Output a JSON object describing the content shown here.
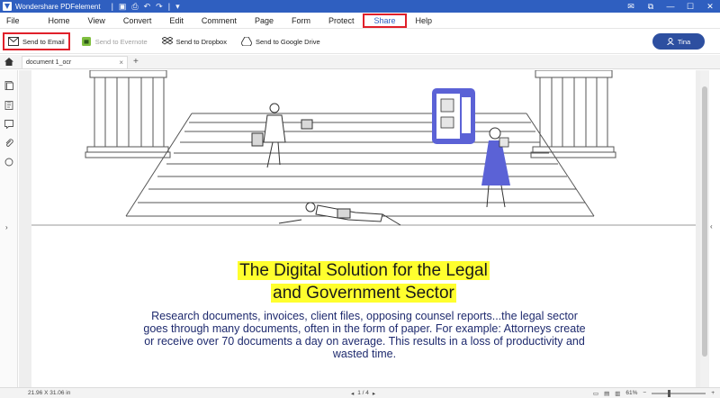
{
  "window": {
    "title": "Wondershare PDFelement"
  },
  "menu": [
    {
      "label": "File"
    },
    {
      "label": "Home"
    },
    {
      "label": "View"
    },
    {
      "label": "Convert"
    },
    {
      "label": "Edit"
    },
    {
      "label": "Comment"
    },
    {
      "label": "Page"
    },
    {
      "label": "Form"
    },
    {
      "label": "Protect"
    },
    {
      "label": "Share",
      "active": true
    },
    {
      "label": "Help"
    }
  ],
  "toolbar": {
    "send_email": "Send to Email",
    "send_evernote": "Send to Evernote",
    "send_dropbox": "Send to Dropbox",
    "send_gdrive": "Send to Google Drive",
    "user": "Tina"
  },
  "tabs": {
    "doc": "document 1_ocr"
  },
  "document": {
    "title_line1": "The Digital Solution for the Legal",
    "title_line2": "and Government Sector",
    "body": "Research documents, invoices, client files, opposing counsel reports...the legal sector goes through many documents, often in the form of paper. For example: Attorneys create or receive over 70 documents a day on average. This results in a loss of productivity and wasted time."
  },
  "status": {
    "dimensions": "21.96 X 31.06 in",
    "page": "1 / 4",
    "zoom": "61%"
  },
  "colors": {
    "titlebar": "#2f5fc0",
    "accent": "#2d4fa0",
    "highlight": "#ffff2e",
    "annotation": "#e0202a"
  }
}
